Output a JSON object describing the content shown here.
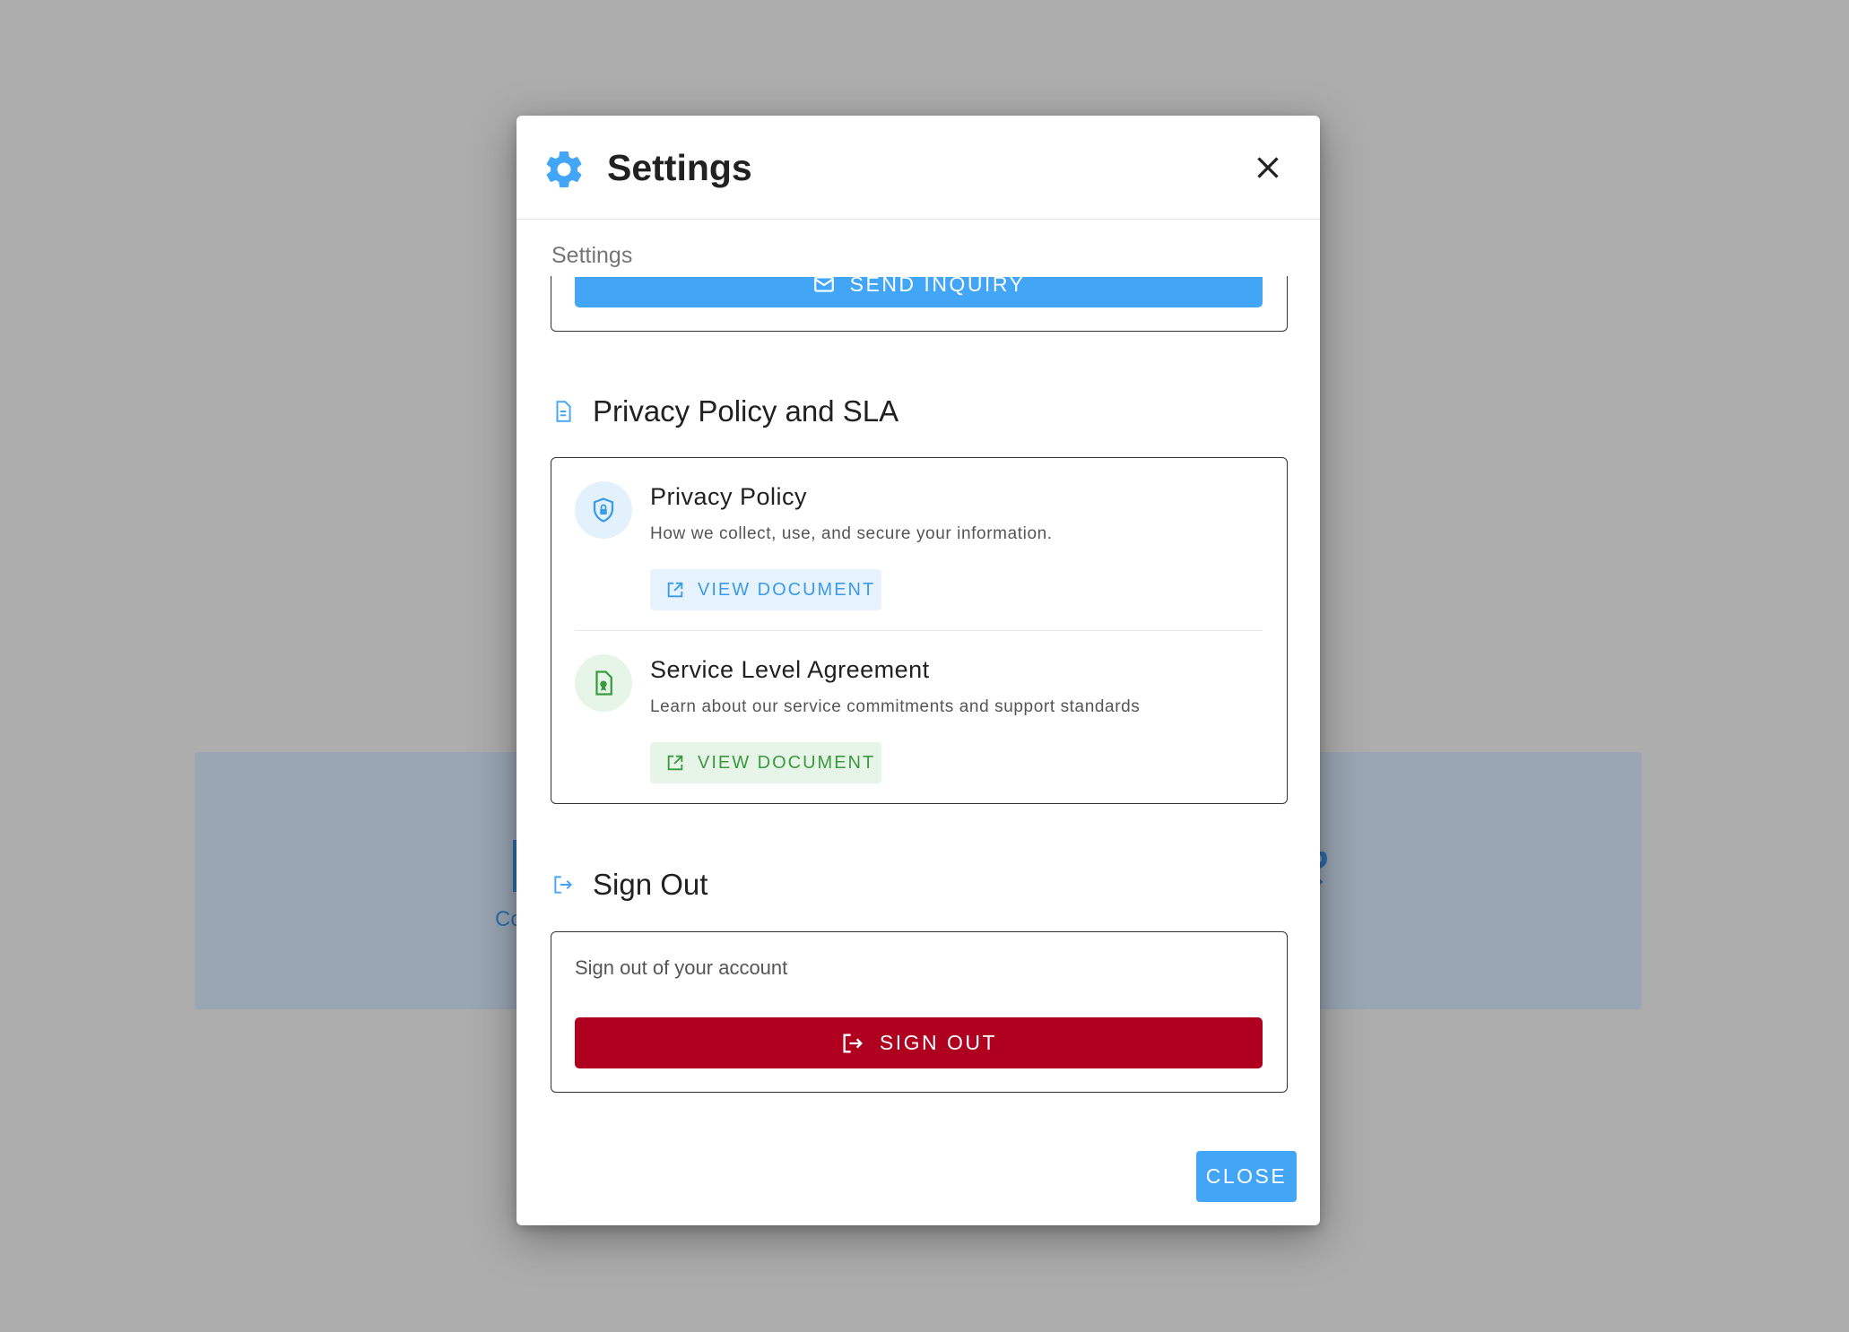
{
  "colors": {
    "primary": "#42a5f5",
    "danger": "#b00020",
    "green": "#3a9a3e"
  },
  "dialog": {
    "title": "Settings",
    "title_icon": "gear-icon",
    "close_icon": "close-icon"
  },
  "body": {
    "section_caption": "Settings",
    "inquiry": {
      "button_label": "SEND INQUIRY",
      "button_icon": "mail-icon"
    },
    "privacy_section": {
      "heading": "Privacy Policy and SLA",
      "heading_icon": "document-icon",
      "documents": [
        {
          "title": "Privacy Policy",
          "description": "How we collect, use, and secure your information.",
          "button_label": "VIEW DOCUMENT",
          "icon": "shield-lock-icon"
        },
        {
          "title": "Service Level Agreement",
          "description": "Learn about our service commitments and support standards",
          "button_label": "VIEW DOCUMENT",
          "icon": "document-certificate-icon"
        }
      ]
    },
    "signout_section": {
      "heading": "Sign Out",
      "heading_icon": "logout-icon",
      "description": "Sign out of your account",
      "button_label": "SIGN OUT"
    }
  },
  "footer": {
    "close_label": "CLOSE"
  },
  "background": {
    "fragment_left": "Co"
  }
}
